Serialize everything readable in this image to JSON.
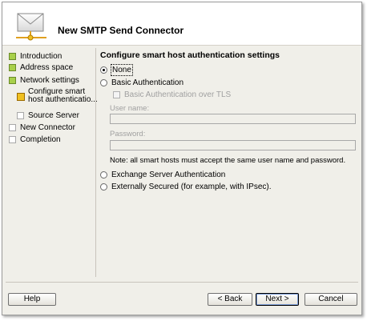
{
  "window": {
    "title": "New SMTP Send Connector"
  },
  "nav": {
    "items": [
      {
        "label": "Introduction",
        "state": "done"
      },
      {
        "label": "Address space",
        "state": "done"
      },
      {
        "label": "Network settings",
        "state": "done"
      },
      {
        "label": "Configure smart",
        "label2": "host authenticatio...",
        "state": "current"
      },
      {
        "label": "Source Server",
        "state": "pending"
      },
      {
        "label": "New Connector",
        "state": "pending"
      },
      {
        "label": "Completion",
        "state": "pending"
      }
    ]
  },
  "content": {
    "heading": "Configure smart host authentication settings",
    "options": {
      "none": "None",
      "basic": "Basic Authentication",
      "basic_tls": "Basic Authentication over TLS",
      "exchange": "Exchange Server Authentication",
      "external": "Externally Secured (for example, with IPsec)."
    },
    "selected": "none",
    "username_label": "User name:",
    "username_value": "",
    "password_label": "Password:",
    "password_value": "",
    "note": "Note: all smart hosts must accept the same user name and password."
  },
  "buttons": {
    "help": "Help",
    "back": "< Back",
    "next": "Next >",
    "cancel": "Cancel"
  },
  "colors": {
    "done": "#a8d04a",
    "current": "#f0c020",
    "pending": "#ffffff",
    "window_bg": "#f0efe9"
  }
}
